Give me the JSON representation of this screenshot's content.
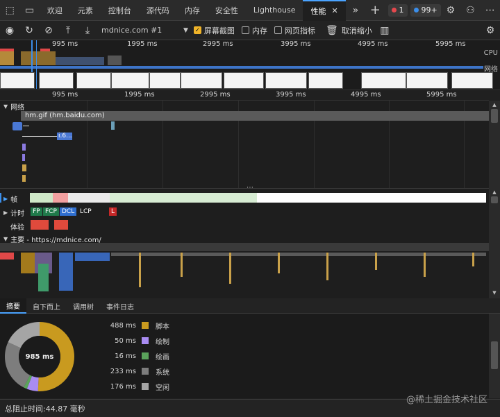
{
  "tabs": [
    {
      "label": "欢迎"
    },
    {
      "label": "元素"
    },
    {
      "label": "控制台"
    },
    {
      "label": "源代码"
    },
    {
      "label": "内存"
    },
    {
      "label": "安全性"
    },
    {
      "label": "Lighthouse"
    },
    {
      "label": "性能"
    }
  ],
  "badges": {
    "errors": "1",
    "messages": "99+"
  },
  "toolbar": {
    "url": "mdnice.com #1",
    "screenshots_label": "屏幕截图",
    "screenshots_checked": true,
    "memory_label": "内存",
    "memory_checked": false,
    "webvitals_label": "网页指标",
    "webvitals_checked": false,
    "zoom_label": "取消缩小"
  },
  "ruler": {
    "ticks": [
      "995 ms",
      "1995 ms",
      "2995 ms",
      "3995 ms",
      "4995 ms",
      "5995 ms"
    ]
  },
  "overview": {
    "cpu_label": "CPU",
    "net_label": "网络"
  },
  "network": {
    "section_label": "网络",
    "request_label": "hm.gif (hm.baidu.com)",
    "small_label": "i.6..."
  },
  "tracks": {
    "frames_label": "帧",
    "timings_label": "计时",
    "timing_markers": [
      "FP",
      "FCP",
      "DCL",
      "LCP",
      "L"
    ],
    "experience_label": "体验",
    "main_label": "主要 - https://mdnice.com/"
  },
  "bottom_tabs": [
    {
      "label": "摘要"
    },
    {
      "label": "自下而上"
    },
    {
      "label": "调用树"
    },
    {
      "label": "事件日志"
    }
  ],
  "summary": {
    "total": "985 ms",
    "items": [
      {
        "value": "488 ms",
        "name": "脚本",
        "color": "#c99a1f"
      },
      {
        "value": "50 ms",
        "name": "绘制",
        "color": "#a98cf2"
      },
      {
        "value": "16 ms",
        "name": "绘画",
        "color": "#5aa35b"
      },
      {
        "value": "233 ms",
        "name": "系统",
        "color": "#7d7d7d"
      },
      {
        "value": "176 ms",
        "name": "空闲",
        "color": "#a5a5a5"
      }
    ]
  },
  "status": {
    "text": "总阻止时间:44.87 毫秒"
  },
  "watermark": "@稀土掘金技术社区"
}
